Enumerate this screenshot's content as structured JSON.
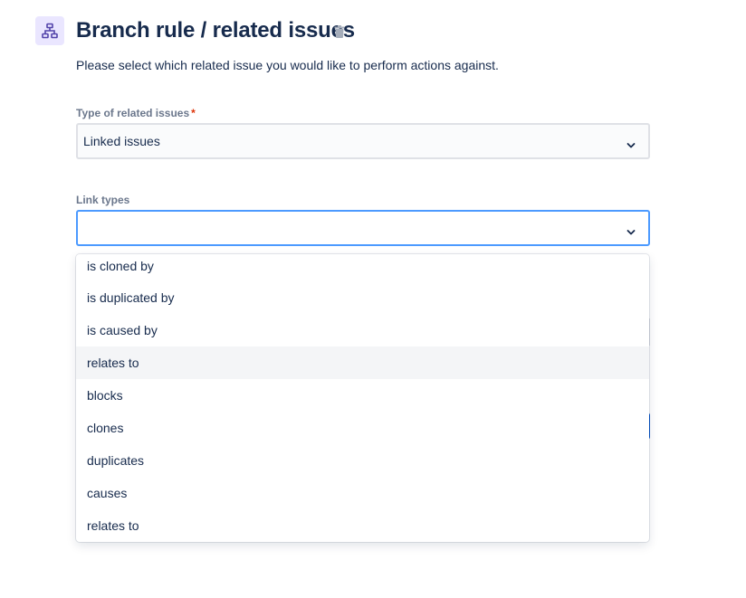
{
  "header": {
    "icon": "branch-hierarchy-icon",
    "title": "Branch rule / related issues",
    "delete_icon": "trash-icon",
    "subtitle": "Please select which related issue you would like to perform actions against."
  },
  "colors": {
    "accent": "#4c9aff",
    "icon_bg": "#eae6ff",
    "icon_fg": "#5243aa",
    "required": "#de350b",
    "text": "#172b4d",
    "label": "#6b778c"
  },
  "fields": {
    "related_type": {
      "label": "Type of related issues",
      "required_marker": "*",
      "value": "Linked issues"
    },
    "link_types": {
      "label": "Link types",
      "value": "",
      "options": [
        "is cloned by",
        "is duplicated by",
        "is caused by",
        "relates to",
        "blocks",
        "clones",
        "duplicates",
        "causes",
        "relates to"
      ],
      "highlighted_option": "relates to"
    }
  }
}
